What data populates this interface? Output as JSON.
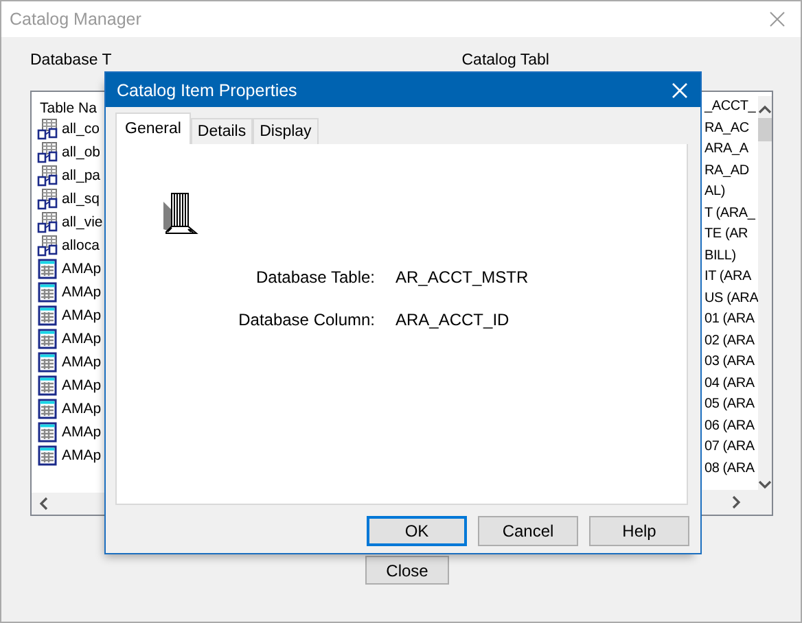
{
  "window": {
    "title": "Catalog Manager"
  },
  "labels": {
    "database_tables": "Database T",
    "catalog_tables": "Catalog Tabl"
  },
  "table_list": {
    "header": "Table Na",
    "rows": [
      {
        "name": "all_co",
        "kind": "view"
      },
      {
        "name": "all_ob",
        "kind": "view"
      },
      {
        "name": "all_pa",
        "kind": "view"
      },
      {
        "name": "all_sq",
        "kind": "view"
      },
      {
        "name": "all_vie",
        "kind": "view"
      },
      {
        "name": "alloca",
        "kind": "view"
      },
      {
        "name": "AMAp",
        "kind": "table"
      },
      {
        "name": "AMAp",
        "kind": "table"
      },
      {
        "name": "AMAp",
        "kind": "table"
      },
      {
        "name": "AMAp",
        "kind": "table"
      },
      {
        "name": "AMAp",
        "kind": "table"
      },
      {
        "name": "AMAp",
        "kind": "table"
      },
      {
        "name": "AMAp",
        "kind": "table"
      },
      {
        "name": "AMAp",
        "kind": "table"
      },
      {
        "name": "AMAp",
        "kind": "table"
      }
    ]
  },
  "catalog_list": {
    "rows": [
      "_ACCT_",
      "RA_AC",
      "ARA_A",
      "RA_AD",
      "AL)",
      "T (ARA_",
      "TE (AR",
      "BILL)",
      "IT (ARA",
      "US (ARA",
      "01 (ARA",
      "02 (ARA",
      "03 (ARA",
      "04 (ARA",
      "05 (ARA",
      "06 (ARA",
      "07 (ARA",
      "08 (ARA"
    ]
  },
  "close_button": "Close",
  "dialog": {
    "title": "Catalog Item Properties",
    "tabs": [
      {
        "label": "General",
        "selected": true
      },
      {
        "label": "Details",
        "selected": false
      },
      {
        "label": "Display",
        "selected": false
      }
    ],
    "fields": [
      {
        "label": "Database Table:",
        "value": "AR_ACCT_MSTR"
      },
      {
        "label": "Database Column:",
        "value": "ARA_ACCT_ID"
      }
    ],
    "buttons": [
      {
        "label": "OK",
        "default": true
      },
      {
        "label": "Cancel",
        "default": false
      },
      {
        "label": "Help",
        "default": false
      }
    ]
  }
}
